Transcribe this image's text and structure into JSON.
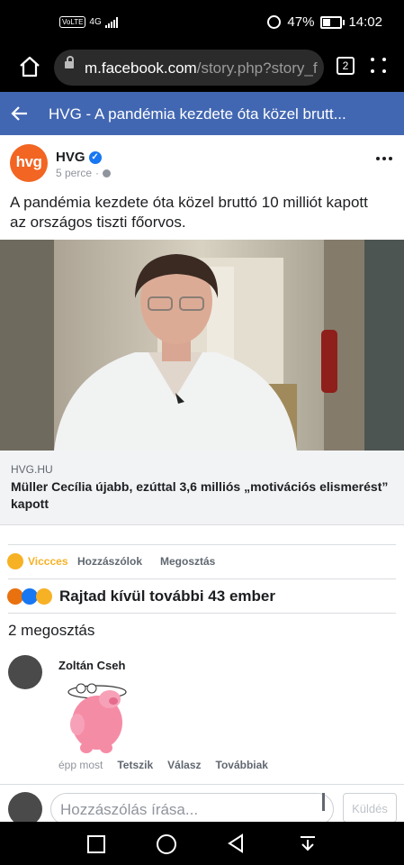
{
  "status_bar": {
    "network": "VoLTE",
    "net_type": "4G",
    "battery": "47%",
    "time": "14:02"
  },
  "browser": {
    "url_domain": "m.facebook.com",
    "url_path": "/story.php?story_f",
    "tab_count": "2"
  },
  "header": {
    "title": "HVG - A pandémia kezdete óta közel brutt..."
  },
  "post": {
    "page_avatar_text": "hvg",
    "page_name": "HVG",
    "verified_mark": "✓",
    "time": "5 perce",
    "separator": "·",
    "text": "A pandémia kezdete óta közel bruttó 10 milliót kapott az országos tiszti főorvos.",
    "link": {
      "domain": "HVG.HU",
      "title": "Müller Cecília újabb, ezúttal 3,6 milliós „motivációs elismerést” kapott"
    }
  },
  "actions": {
    "reaction": "Viccces",
    "comment": "Hozzászólok",
    "share": "Megosztás"
  },
  "reactions_summary": "Rajtad kívül további 43 ember",
  "shares": "2 megosztás",
  "comment": {
    "author": "Zoltán Cseh",
    "time": "épp most",
    "like": "Tetszik",
    "reply": "Válasz",
    "more": "Továbbiak"
  },
  "composer": {
    "placeholder": "Hozzászólás írása...",
    "send": "Küldés"
  },
  "colors": {
    "facebook_blue": "#4267b2",
    "hvg_orange": "#f26522",
    "haha_yellow": "#f7b125"
  }
}
